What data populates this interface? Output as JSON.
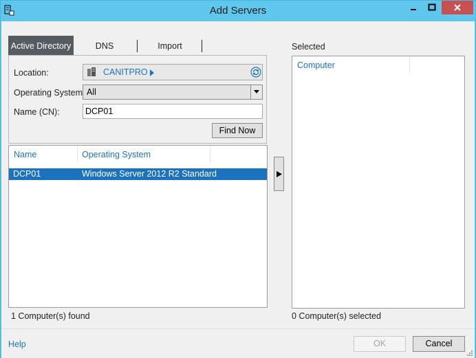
{
  "window": {
    "title": "Add Servers",
    "controls": [
      "minimize-icon",
      "maximize-icon",
      "close-icon"
    ]
  },
  "tabs": [
    {
      "label": "Active Directory",
      "active": true
    },
    {
      "label": "DNS",
      "active": false
    },
    {
      "label": "Import",
      "active": false
    }
  ],
  "search": {
    "location_label": "Location:",
    "location_value": "CANITPRO",
    "os_label": "Operating System:",
    "os_value": "All",
    "name_label": "Name (CN):",
    "name_value": "DCP01",
    "find_button": "Find Now"
  },
  "results": {
    "columns": [
      "Name",
      "Operating System"
    ],
    "rows": [
      {
        "name": "DCP01",
        "os": "Windows Server 2012 R2 Standard",
        "selected": true
      }
    ],
    "status": "1 Computer(s) found"
  },
  "selected": {
    "label": "Selected",
    "column": "Computer",
    "status": "0 Computer(s) selected"
  },
  "footer": {
    "help": "Help",
    "ok": "OK",
    "cancel": "Cancel"
  },
  "colors": {
    "titlebar": "#5fc6ec",
    "close": "#c75050",
    "accent": "#1b73bf",
    "active_tab": "#555b5f"
  }
}
